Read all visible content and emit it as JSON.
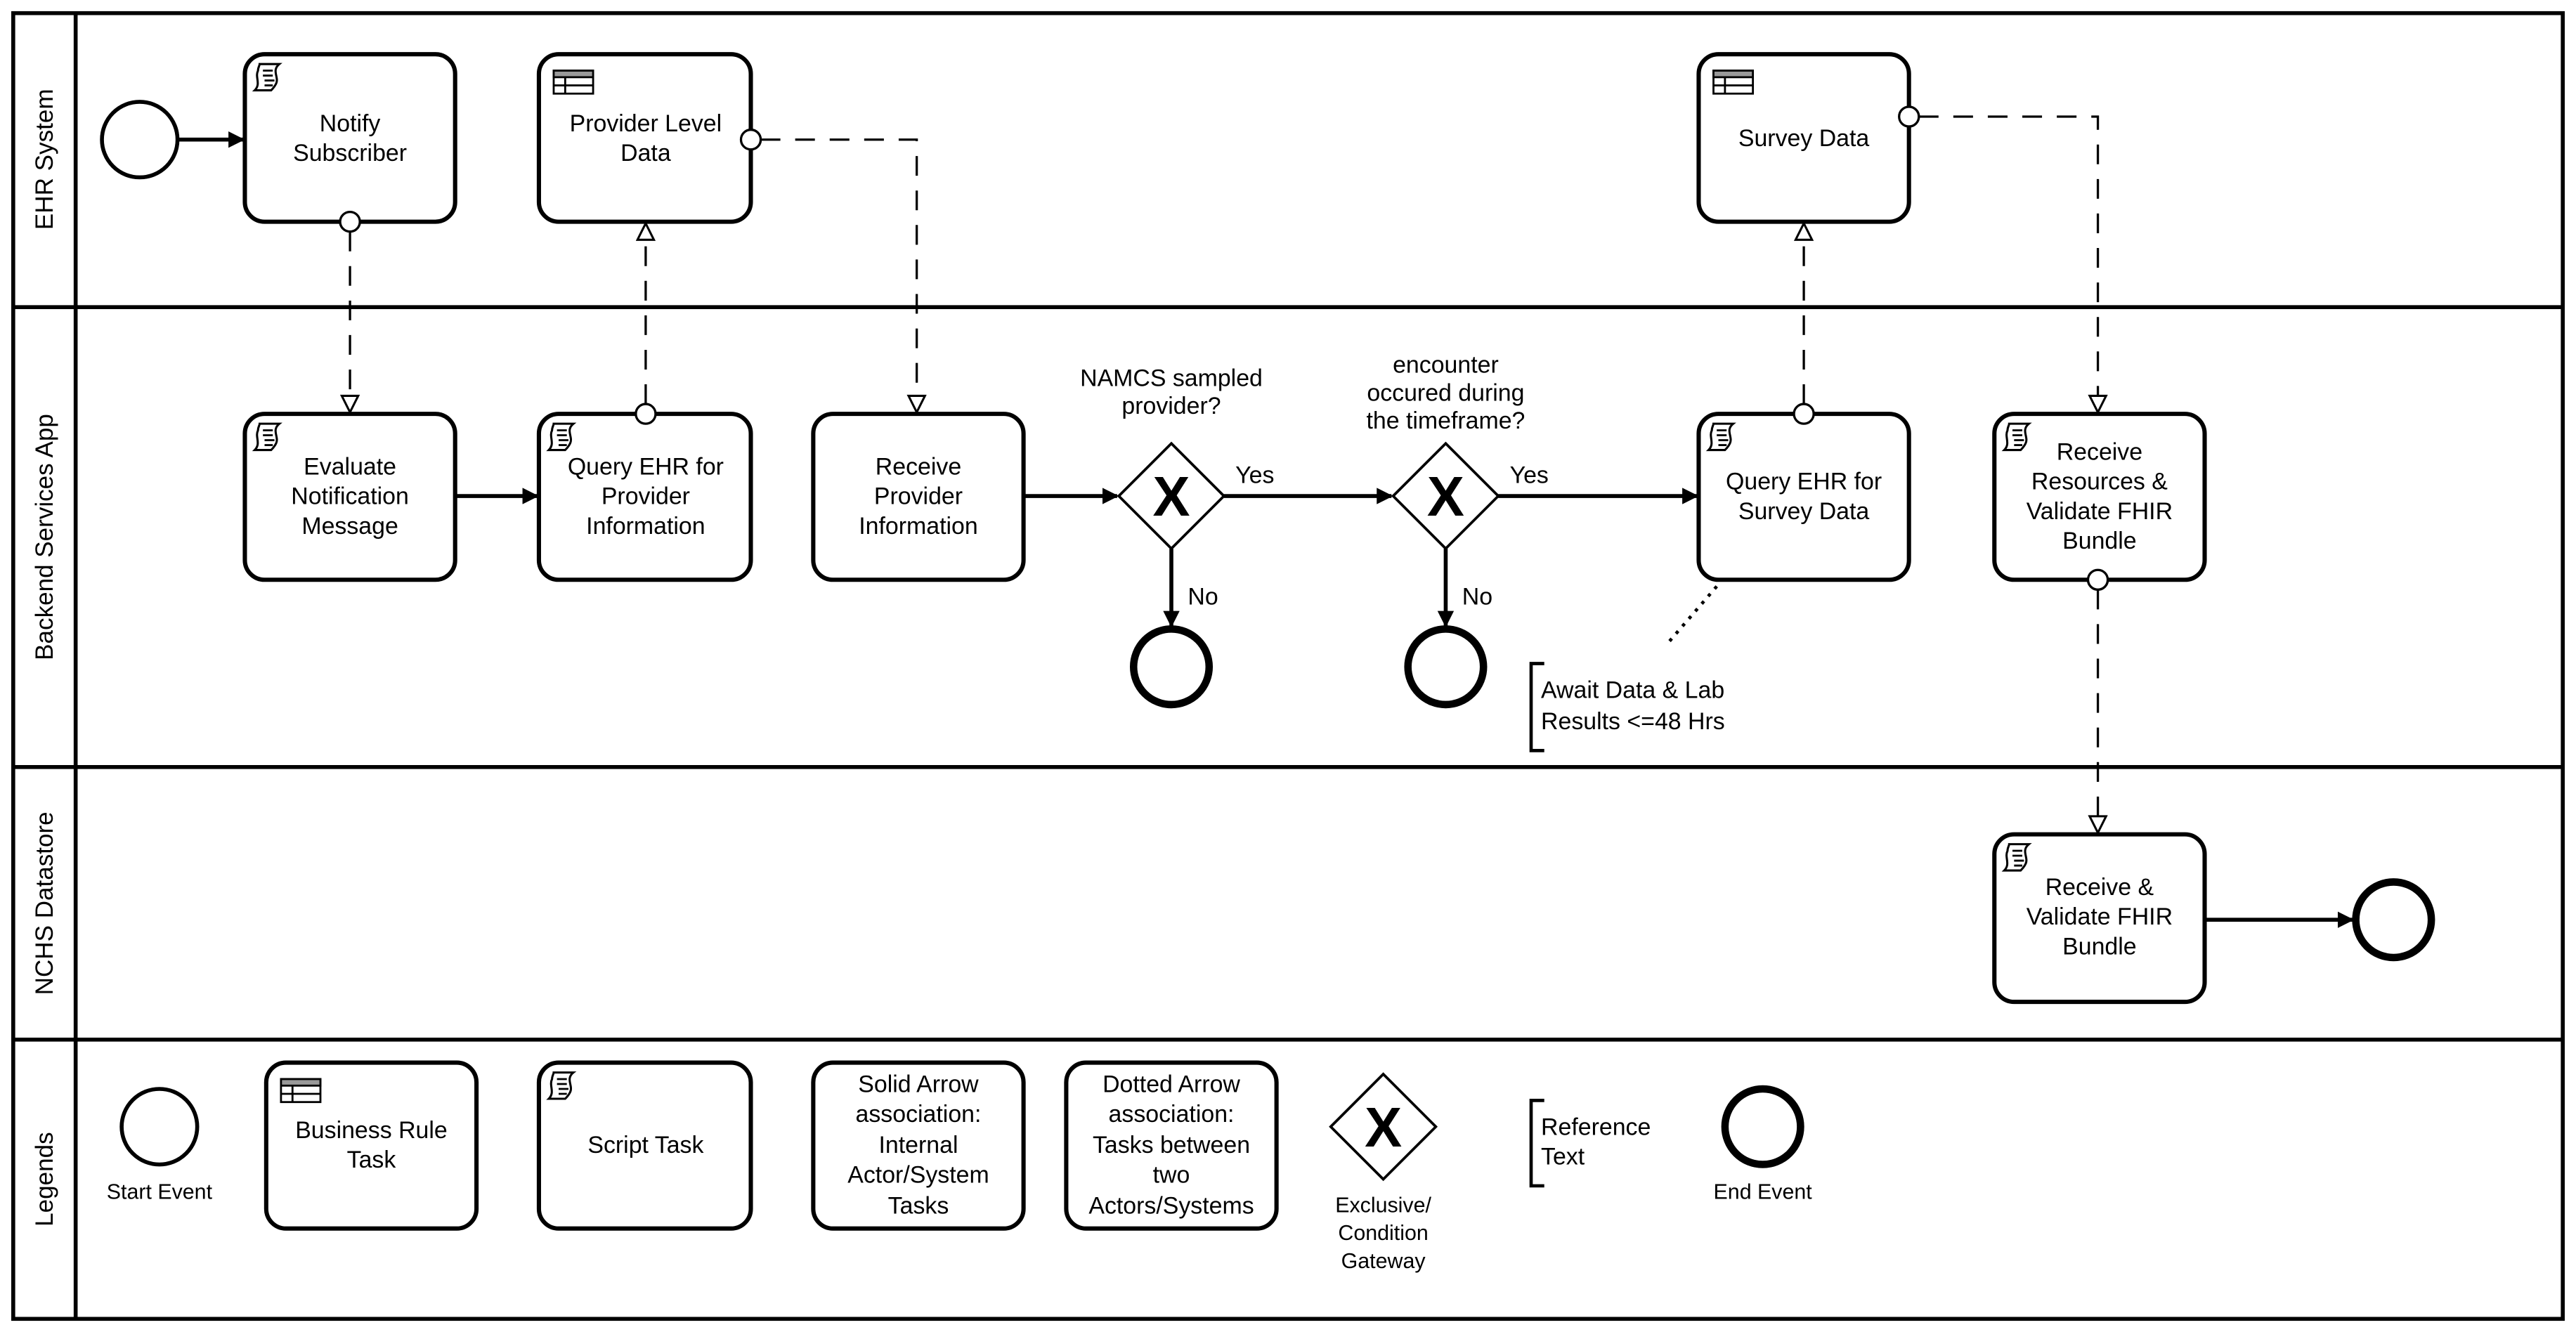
{
  "lanes": [
    "EHR System",
    "Backend Services App",
    "NCHS Datastore",
    "Legends"
  ],
  "tasks": {
    "notify_subscriber": [
      "Notify",
      "Subscriber"
    ],
    "provider_level_data": [
      "Provider Level",
      "Data"
    ],
    "survey_data": [
      "Survey Data"
    ],
    "evaluate_notification": [
      "Evaluate",
      "Notification",
      "Message"
    ],
    "query_ehr_provider": [
      "Query EHR for",
      "Provider",
      "Information"
    ],
    "receive_provider": [
      "Receive",
      "Provider",
      "Information"
    ],
    "query_ehr_survey": [
      "Query EHR for",
      "Survey Data"
    ],
    "receive_resources": [
      "Receive",
      "Resources &",
      "Validate FHIR",
      "Bundle"
    ],
    "receive_validate": [
      "Receive &",
      "Validate FHIR",
      "Bundle"
    ]
  },
  "gateways": {
    "g1_question": [
      "NAMCS sampled",
      "provider?"
    ],
    "g2_question": [
      "encounter",
      "occured during",
      "the timeframe?"
    ],
    "yes": "Yes",
    "no": "No",
    "marker": "X"
  },
  "annotation": [
    "Await Data & Lab",
    "Results <=48 Hrs"
  ],
  "legend": {
    "start_event": "Start Event",
    "business_rule_task": [
      "Business Rule",
      "Task"
    ],
    "script_task": "Script Task",
    "solid_arrow": [
      "Solid Arrow",
      "association:",
      "Internal",
      "Actor/System",
      "Tasks"
    ],
    "dotted_arrow": [
      "Dotted Arrow",
      "association:",
      "Tasks between",
      "two",
      "Actors/Systems"
    ],
    "gateway": [
      "Exclusive/",
      "Condition",
      "Gateway"
    ],
    "reference": [
      "Reference",
      "Text"
    ],
    "end_event": "End Event"
  },
  "icons": {
    "script": "script-icon",
    "business_rule": "table-icon",
    "gateway": "x-icon"
  }
}
